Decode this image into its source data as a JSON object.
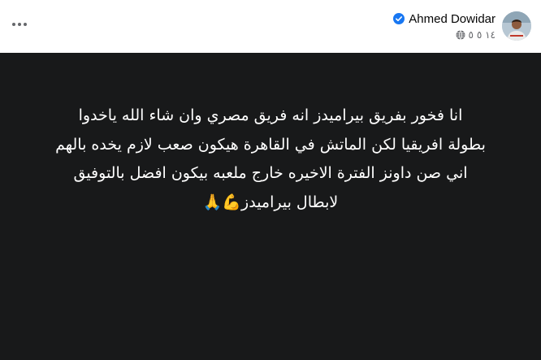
{
  "header": {
    "author_name": "Ahmed Dowidar",
    "timestamp": "١٤ ٥ ٥",
    "verified": true,
    "audience_icon": "globe-icon",
    "menu_icon": "more-horizontal-icon"
  },
  "post": {
    "background_color": "#18191a",
    "text_color": "#ffffff",
    "lines": [
      "انا فخور بفريق بيراميدز انه فريق مصري وان شاء الله ياخدوا",
      "بطولة افريقيا لكن الماتش في القاهرة هيكون صعب لازم يخده بالهم",
      "اني صن داونز الفترة الاخيره خارج ملعبه بيكون افضل بالتوفيق",
      "لابطال بيراميدز💪🙏"
    ]
  },
  "colors": {
    "verified_blue": "#1877f2",
    "secondary_text": "#65676b"
  }
}
